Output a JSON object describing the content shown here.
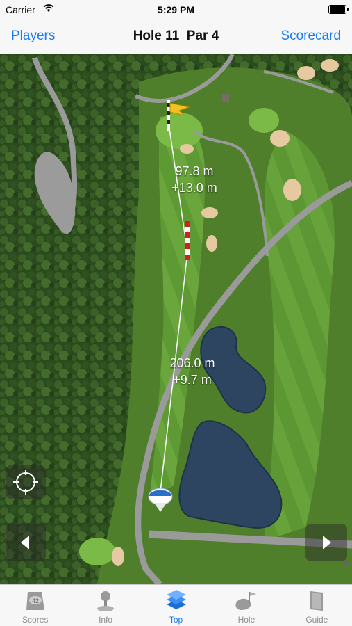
{
  "status_bar": {
    "carrier": "Carrier",
    "time": "5:29 PM"
  },
  "nav": {
    "left_button": "Players",
    "title": "Hole 11  Par 4",
    "right_button": "Scorecard"
  },
  "map": {
    "distance_to_pin": {
      "distance": "97.8 m",
      "elevation": "+13.0 m"
    },
    "distance_from_tee": {
      "distance": "206.0 m",
      "elevation": "+9.7 m"
    }
  },
  "tabs": [
    {
      "label": "Scores",
      "icon": "scores-icon",
      "active": false
    },
    {
      "label": "Info",
      "icon": "info-icon",
      "active": false
    },
    {
      "label": "Top",
      "icon": "top-icon",
      "active": true
    },
    {
      "label": "Hole",
      "icon": "hole-icon",
      "active": false
    },
    {
      "label": "Guide",
      "icon": "guide-icon",
      "active": false
    }
  ],
  "colors": {
    "accent": "#1a7cf4",
    "fairway": "#5c9a35",
    "water": "#2d4560",
    "sand": "#e6c9a1",
    "path": "#9a9a9a"
  }
}
